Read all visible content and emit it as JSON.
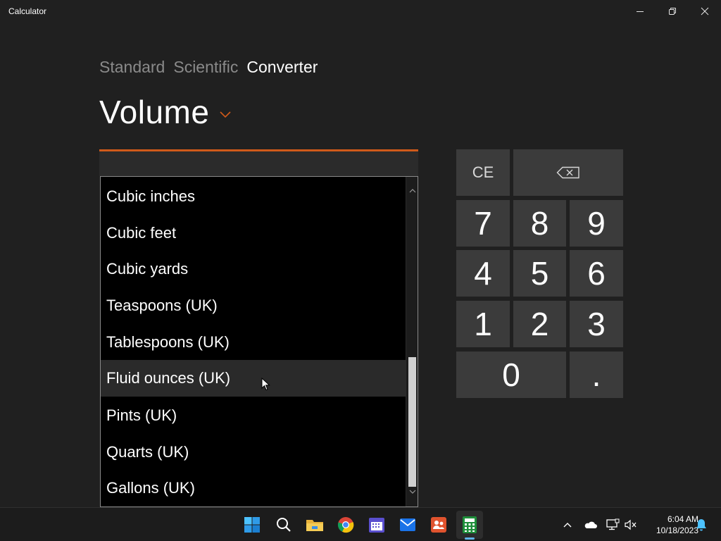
{
  "window": {
    "title": "Calculator"
  },
  "tabs": [
    {
      "label": "Standard",
      "active": false
    },
    {
      "label": "Scientific",
      "active": false
    },
    {
      "label": "Converter",
      "active": true
    }
  ],
  "category": {
    "label": "Volume"
  },
  "unit_list": {
    "items": [
      "Cubic inches",
      "Cubic feet",
      "Cubic yards",
      "Teaspoons (UK)",
      "Tablespoons (UK)",
      "Fluid ounces (UK)",
      "Pints (UK)",
      "Quarts (UK)",
      "Gallons (UK)"
    ],
    "selected": "Fluid ounces (UK)"
  },
  "keypad": {
    "ce": "CE",
    "backspace_icon": "backspace-icon",
    "digits": [
      "7",
      "8",
      "9",
      "4",
      "5",
      "6",
      "1",
      "2",
      "3",
      "0",
      "."
    ]
  },
  "taskbar": {
    "apps": [
      "start-icon",
      "search-icon",
      "file-explorer-icon",
      "chrome-icon",
      "calendar-icon",
      "mail-icon",
      "teams-icon",
      "calculator-icon"
    ],
    "active_app": "calculator-icon",
    "clock_time": "6:04 AM",
    "clock_date": "10/18/2023"
  },
  "colors": {
    "background": "#202020",
    "accent": "#d05a1a",
    "key": "#3b3b3b",
    "list_bg": "#000000",
    "selected_row": "#2a2a2a"
  }
}
